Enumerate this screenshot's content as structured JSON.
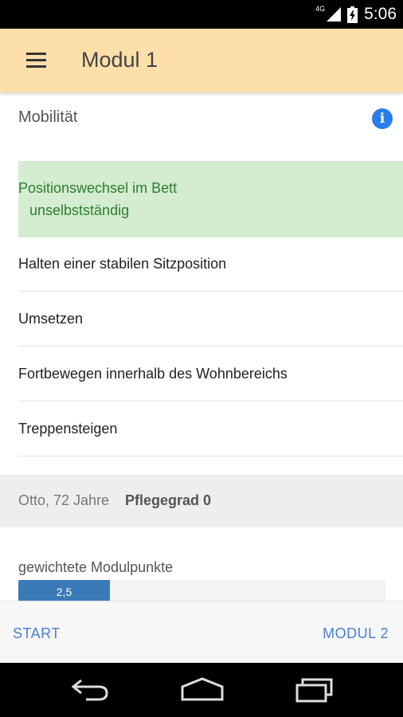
{
  "status_bar": {
    "network": "4G",
    "time": "5:06"
  },
  "app_bar": {
    "title": "Modul 1",
    "menu_icon": "hamburger-menu-icon"
  },
  "section": {
    "title": "Mobilität",
    "info_icon": "info-icon",
    "info_glyph": "i"
  },
  "items": [
    {
      "label": "Positionswechsel im Bett",
      "value": "unselbstständig",
      "selected": true
    },
    {
      "label": "Halten einer stabilen Sitzposition"
    },
    {
      "label": "Umsetzen"
    },
    {
      "label": "Fortbewegen innerhalb des Wohnbereichs"
    },
    {
      "label": "Treppensteigen"
    }
  ],
  "patient": {
    "info": "Otto, 72 Jahre",
    "grade": "Pflegegrad 0"
  },
  "points": {
    "label": "gewichtete Modulpunkte",
    "value_text": "2,5",
    "fraction": 0.25
  },
  "actions": {
    "start": "START",
    "next": "MODUL 2"
  },
  "colors": {
    "app_bar": "#fddfaa",
    "selected_bg": "#d4ecd0",
    "selected_text": "#2e7d32",
    "accent": "#4a7fd0",
    "progress": "#3a7ab8",
    "info": "#2b7de9"
  },
  "nav_icons": [
    "back-icon",
    "home-icon",
    "recents-icon"
  ]
}
